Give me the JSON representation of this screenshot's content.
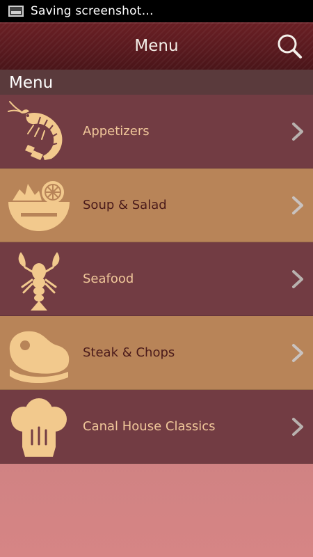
{
  "status_bar": {
    "text": "Saving screenshot…",
    "icon": "image-icon"
  },
  "app_bar": {
    "title": "Menu",
    "search_icon": "search-icon"
  },
  "section": {
    "title": "Menu"
  },
  "menu_items": [
    {
      "label": "Appetizers",
      "icon": "shrimp-icon",
      "style": "dark"
    },
    {
      "label": "Soup & Salad",
      "icon": "salad-bowl-icon",
      "style": "light"
    },
    {
      "label": "Seafood",
      "icon": "lobster-icon",
      "style": "dark"
    },
    {
      "label": "Steak & Chops",
      "icon": "steak-icon",
      "style": "light"
    },
    {
      "label": "Canal House Classics",
      "icon": "chef-hat-icon",
      "style": "dark"
    }
  ],
  "colors": {
    "icon_fill": "#f2c98d",
    "dark_row": "#723c43",
    "light_row": "#b88458",
    "app_bar": "#5a1a1f",
    "section_header": "#5a3a3c"
  }
}
